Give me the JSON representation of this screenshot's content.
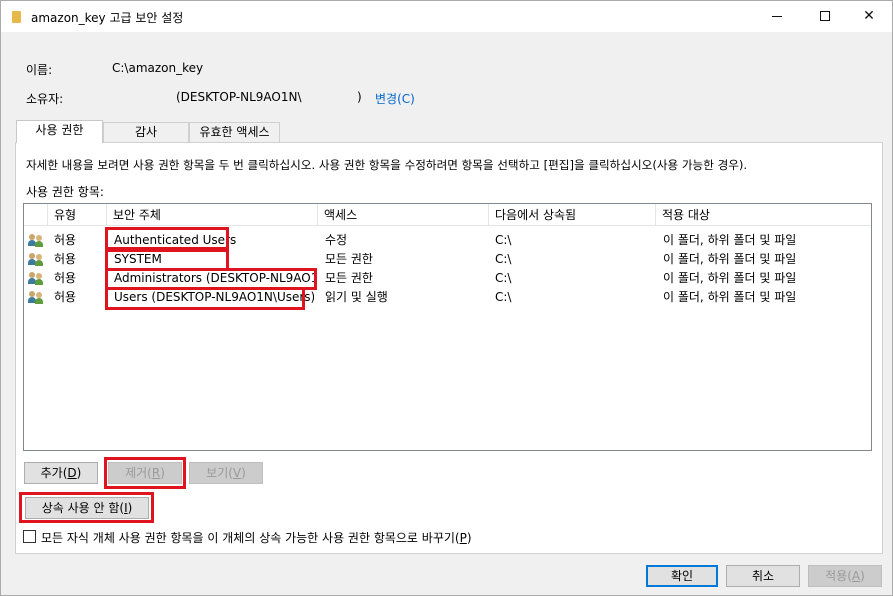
{
  "window": {
    "title": "amazon_key 고급 보안 설정"
  },
  "fields": {
    "name_label": "이름:",
    "name_value": "C:\\amazon_key",
    "owner_label": "소유자:",
    "owner_value_open": "(DESKTOP-NL9AO1N\\",
    "owner_value_close": ")",
    "change_link": "변경(C)"
  },
  "tabs": [
    {
      "label": "사용 권한"
    },
    {
      "label": "감사"
    },
    {
      "label": "유효한 액세스"
    }
  ],
  "instructions": "자세한 내용을 보려면 사용 권한 항목을 두 번 클릭하십시오. 사용 권한 항목을 수정하려면 항목을 선택하고 [편집]을 클릭하십시오(사용 가능한 경우).",
  "entries_label": "사용 권한 항목:",
  "table": {
    "columns": [
      "유형",
      "보안 주체",
      "액세스",
      "다음에서 상속됨",
      "적용 대상"
    ],
    "rows": [
      {
        "type": "허용",
        "principal": "Authenticated Users",
        "access": "수정",
        "inherited": "C:\\",
        "applies": "이 폴더, 하위 폴더 및 파일"
      },
      {
        "type": "허용",
        "principal": "SYSTEM",
        "access": "모든 권한",
        "inherited": "C:\\",
        "applies": "이 폴더, 하위 폴더 및 파일"
      },
      {
        "type": "허용",
        "principal": "Administrators (DESKTOP-NL9AO1...",
        "access": "모든 권한",
        "inherited": "C:\\",
        "applies": "이 폴더, 하위 폴더 및 파일"
      },
      {
        "type": "허용",
        "principal": "Users (DESKTOP-NL9AO1N\\Users)",
        "access": "읽기 및 실행",
        "inherited": "C:\\",
        "applies": "이 폴더, 하위 폴더 및 파일"
      }
    ]
  },
  "buttons": {
    "add": "추가(",
    "add_key": "D",
    "remove": "제거(",
    "remove_key": "R",
    "view": "보기(",
    "view_key": "V",
    "disable_inheritance": "상속 사용 안 함(",
    "disable_inheritance_key": "I",
    "ok": "확인",
    "cancel": "취소",
    "apply": "적용(",
    "apply_key": "A",
    "close_paren": ")"
  },
  "checkbox": {
    "label": "모든 자식 개체 사용 권한 항목을 이 개체의 상속 가능한 사용 권한 항목으로 바꾸기(",
    "key": "P",
    "checked": false
  },
  "colors": {
    "highlight": "#e0141e",
    "link": "#0066cc"
  },
  "icons": [
    "folder-icon",
    "minimize-icon",
    "maximize-icon",
    "close-icon",
    "user-group-icon"
  ]
}
